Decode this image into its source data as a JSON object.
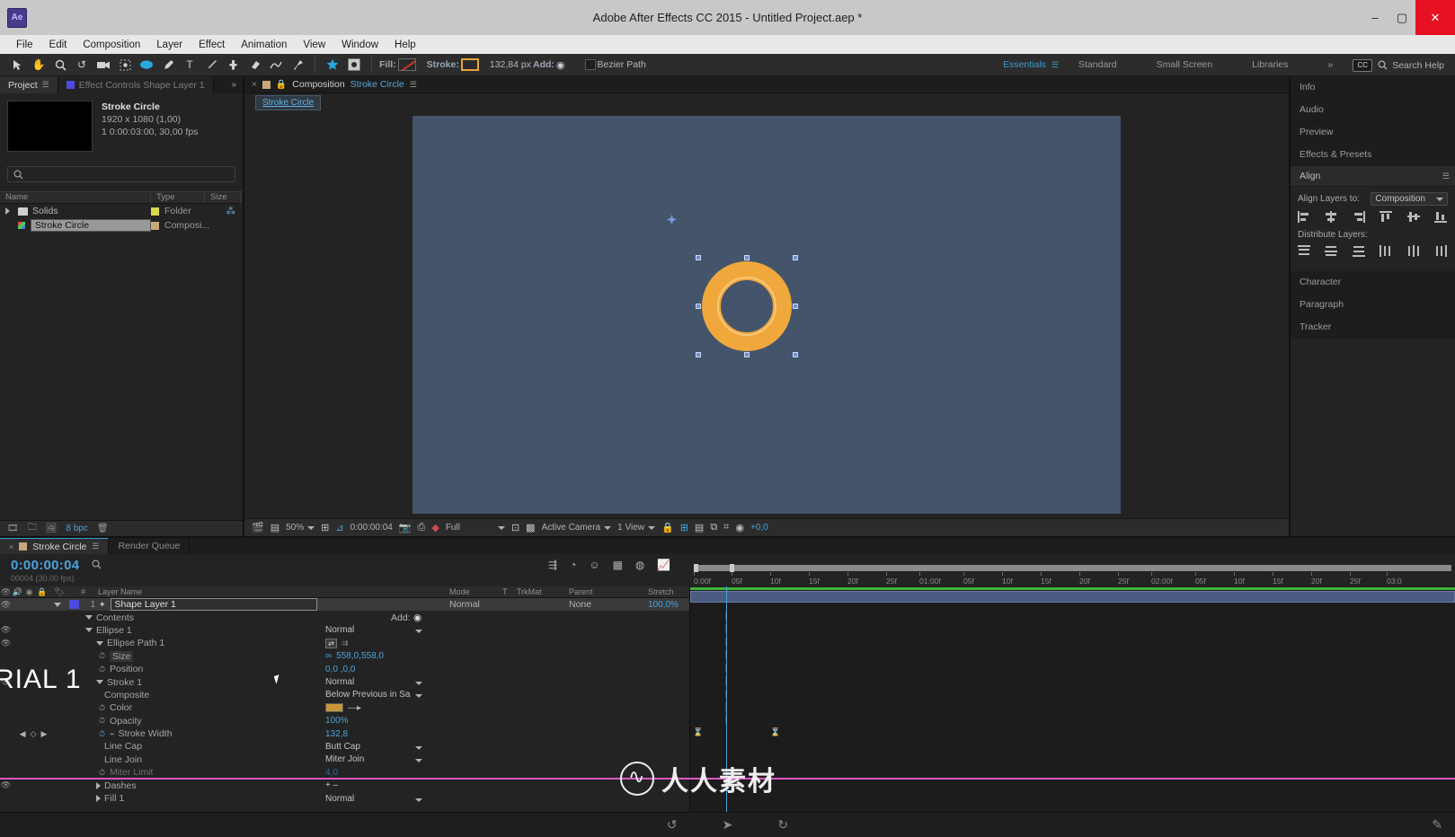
{
  "window": {
    "title": "Adobe After Effects CC 2015 - Untitled Project.aep *",
    "logo": "Ae",
    "minimize": "–",
    "maximize": "▢",
    "close": "✕"
  },
  "menu": [
    "File",
    "Edit",
    "Composition",
    "Layer",
    "Effect",
    "Animation",
    "View",
    "Window",
    "Help"
  ],
  "toolbar": {
    "tools": [
      "selection-tool",
      "hand-tool",
      "zoom-tool",
      "rotation-tool",
      "camera-tool",
      "pan-behind-tool",
      "shape-tool",
      "pen-tool",
      "type-tool",
      "brush-tool",
      "clone-stamp-tool",
      "eraser-tool",
      "roto-brush-tool",
      "puppet-pin-tool"
    ],
    "fill_label": "Fill:",
    "stroke_label": "Stroke:",
    "stroke_width": "132,84 px",
    "add_label": "Add:",
    "bezier_label": "Bezier Path",
    "workspaces": [
      "Essentials",
      "Standard",
      "Small Screen",
      "Libraries"
    ],
    "active_workspace": "Essentials",
    "overflow": "»",
    "search_help": "Search Help",
    "accent_orange": "#e8a33d",
    "accent_blue": "#3c9dd0"
  },
  "project": {
    "tabs": [
      {
        "label": "Project",
        "active": true
      },
      {
        "label": "Effect Controls  Shape Layer 1",
        "active": false
      }
    ],
    "overflow": "»",
    "comp_name": "Stroke Circle",
    "comp_res": "1920 x 1080 (1,00)",
    "comp_duration": "1 0:00:03:00, 30,00 fps",
    "search_placeholder": "",
    "columns": [
      "Name",
      "Type",
      "Size"
    ],
    "rows": [
      {
        "name": "Solids",
        "type": "Folder",
        "kind": "folder",
        "selected": false
      },
      {
        "name": "Stroke Circle",
        "type": "Composi...",
        "kind": "comp",
        "selected": true
      }
    ],
    "footer_bpc": "8 bpc"
  },
  "viewer": {
    "tab_label": "Composition",
    "tab_comp": "Stroke Circle",
    "breadcrumb": "Stroke Circle",
    "zoom": "50%",
    "time": "0:00:00:04",
    "resolution": "Full",
    "camera": "Active Camera",
    "views": "1 View",
    "offset": "+0,0",
    "canvas_bg": "#44556b",
    "shape_color": "#f0a83c"
  },
  "right_panel": {
    "tabs": [
      "Info",
      "Audio",
      "Preview",
      "Effects & Presets"
    ],
    "align": {
      "title": "Align",
      "align_layers_label": "Align Layers to:",
      "align_layers_value": "Composition",
      "distribute_label": "Distribute Layers:"
    },
    "other_sections": [
      "Character",
      "Paragraph",
      "Tracker"
    ]
  },
  "timeline": {
    "tabs": [
      {
        "label": "Stroke Circle",
        "active": true
      },
      {
        "label": "Render Queue",
        "active": false
      }
    ],
    "timecode": "0:00:00:04",
    "frame_info": "00004 (30.00 fps)",
    "columns": [
      "Layer Name",
      "Mode",
      "T",
      "TrkMat",
      "Parent",
      "Stretch"
    ],
    "add_label": "Add:",
    "ruler_ticks": [
      "0:00f",
      "05f",
      "10f",
      "15f",
      "20f",
      "25f",
      "01:00f",
      "05f",
      "10f",
      "15f",
      "20f",
      "25f",
      "02:00f",
      "05f",
      "10f",
      "15f",
      "20f",
      "25f",
      "03:0"
    ],
    "rows": [
      {
        "indent": 0,
        "label": "Shape Layer 1",
        "num": "1",
        "type": "layer",
        "eye": true,
        "selected": true,
        "mode": "Normal",
        "parent": "None",
        "stretch": "100,0%",
        "twirl": "down",
        "editable": true
      },
      {
        "indent": 1,
        "label": "Contents",
        "type": "group",
        "twirl": "down",
        "right": "Add:"
      },
      {
        "indent": 2,
        "label": "Ellipse 1",
        "type": "group",
        "eye": true,
        "twirl": "down",
        "value": "Normal",
        "value_kind": "dropdown"
      },
      {
        "indent": 3,
        "label": "Ellipse Path 1",
        "type": "group",
        "eye": true,
        "twirl": "down",
        "value": "",
        "value_kind": "pathicons"
      },
      {
        "indent": 4,
        "label": "Size",
        "type": "prop",
        "stopwatch": true,
        "value": "558,0,558,0",
        "value_kind": "link",
        "selected_label": true
      },
      {
        "indent": 4,
        "label": "Position",
        "type": "prop",
        "stopwatch": true,
        "value": "0,0 ,0,0",
        "value_kind": "blue"
      },
      {
        "indent": 3,
        "label": "Stroke 1",
        "type": "group",
        "eye": true,
        "twirl": "down",
        "value": "Normal",
        "value_kind": "dropdown"
      },
      {
        "indent": 4,
        "label": "Composite",
        "type": "prop",
        "value": "Below Previous in Sa",
        "value_kind": "dropdown"
      },
      {
        "indent": 4,
        "label": "Color",
        "type": "prop",
        "stopwatch": true,
        "value": "",
        "value_kind": "color"
      },
      {
        "indent": 4,
        "label": "Opacity",
        "type": "prop",
        "stopwatch": true,
        "value": "100%",
        "value_kind": "blue"
      },
      {
        "indent": 4,
        "label": "Stroke Width",
        "type": "prop",
        "stopwatch": true,
        "keyed": true,
        "value": "132,8",
        "value_kind": "blue"
      },
      {
        "indent": 4,
        "label": "Line Cap",
        "type": "prop",
        "value": "Butt Cap",
        "value_kind": "dropdown"
      },
      {
        "indent": 4,
        "label": "Line Join",
        "type": "prop",
        "value": "Miter Join",
        "value_kind": "dropdown"
      },
      {
        "indent": 4,
        "label": "Miter Limit",
        "type": "prop",
        "stopwatch": true,
        "value": "4,0",
        "value_kind": "blue"
      },
      {
        "indent": 3,
        "label": "Dashes",
        "type": "group",
        "eye": true,
        "twirl": "right",
        "value": "+ –",
        "value_kind": "plain"
      },
      {
        "indent": 3,
        "label": "Fill 1",
        "type": "group",
        "twirl": "right",
        "value": "Normal",
        "value_kind": "dropdown"
      }
    ]
  },
  "watermark": {
    "text": "人人素材",
    "overlay_text": "RIAL 1"
  }
}
